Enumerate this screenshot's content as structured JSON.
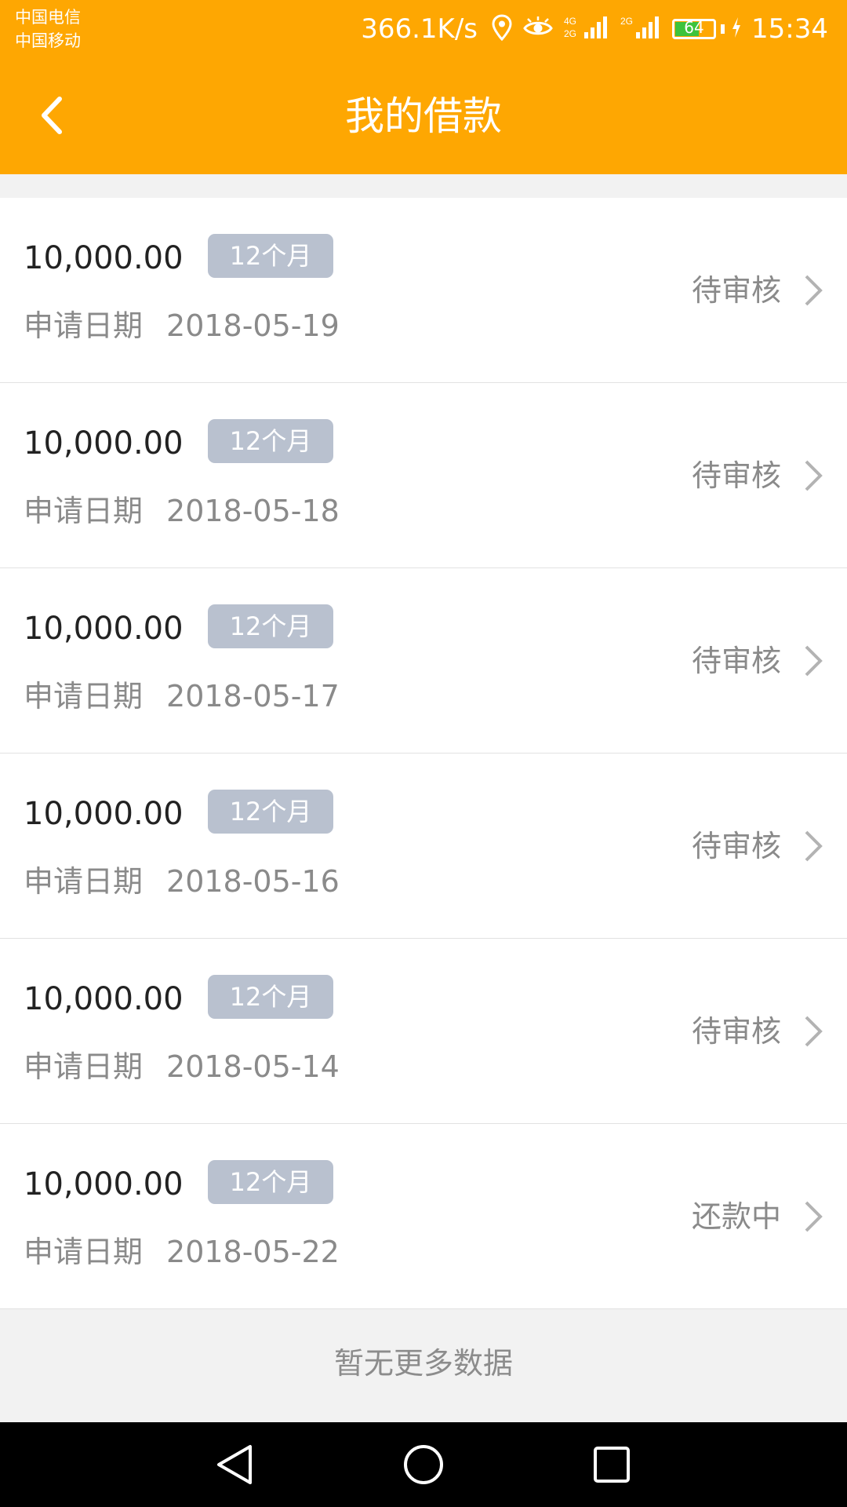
{
  "status_bar": {
    "carrier_1": "中国电信",
    "carrier_2": "中国移动",
    "network_speed": "366.1K/s",
    "network_badge_1": "4G",
    "network_badge_2": "2G",
    "network_badge_3": "2G",
    "battery_level": "64",
    "time": "15:34",
    "icons": [
      "location-icon",
      "eye-icon",
      "signal-icon",
      "signal-icon",
      "battery-icon",
      "charging-icon"
    ]
  },
  "header": {
    "title": "我的借款",
    "back_icon": "back-arrow-icon"
  },
  "loans": [
    {
      "amount": "10,000.00",
      "term": "12个月",
      "date_label": "申请日期",
      "date": "2018-05-19",
      "status": "待审核"
    },
    {
      "amount": "10,000.00",
      "term": "12个月",
      "date_label": "申请日期",
      "date": "2018-05-18",
      "status": "待审核"
    },
    {
      "amount": "10,000.00",
      "term": "12个月",
      "date_label": "申请日期",
      "date": "2018-05-17",
      "status": "待审核"
    },
    {
      "amount": "10,000.00",
      "term": "12个月",
      "date_label": "申请日期",
      "date": "2018-05-16",
      "status": "待审核"
    },
    {
      "amount": "10,000.00",
      "term": "12个月",
      "date_label": "申请日期",
      "date": "2018-05-14",
      "status": "待审核"
    },
    {
      "amount": "10,000.00",
      "term": "12个月",
      "date_label": "申请日期",
      "date": "2018-05-22",
      "status": "还款中"
    }
  ],
  "footer": {
    "no_more_text": "暂无更多数据"
  },
  "nav": {
    "icons": [
      "back-triangle-icon",
      "home-circle-icon",
      "recents-square-icon"
    ]
  },
  "colors": {
    "accent": "#fea702",
    "badge": "#b9c1cf",
    "battery": "#3dc33d",
    "page_bg": "#f2f2f2"
  }
}
